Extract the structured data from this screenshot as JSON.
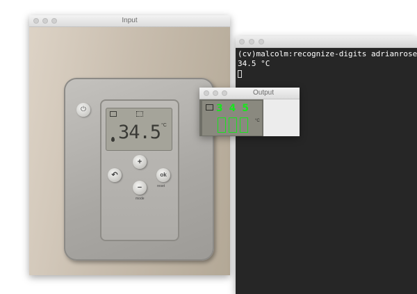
{
  "input_window": {
    "title": "Input",
    "photo": {
      "lcd_reading": "34.5",
      "unit": "°C",
      "buttons": {
        "plus": "+",
        "minus": "−",
        "back": "↶",
        "ok": "ok",
        "power": "⏻"
      },
      "label_mode": "mode",
      "label_reset": "reset"
    }
  },
  "terminal_window": {
    "lines": [
      "(cv)malcolm:recognize-digits adrianroseb",
      "34.5 °C"
    ]
  },
  "output_window": {
    "title": "Output",
    "digits": "3 4 5",
    "unit": "°C"
  }
}
